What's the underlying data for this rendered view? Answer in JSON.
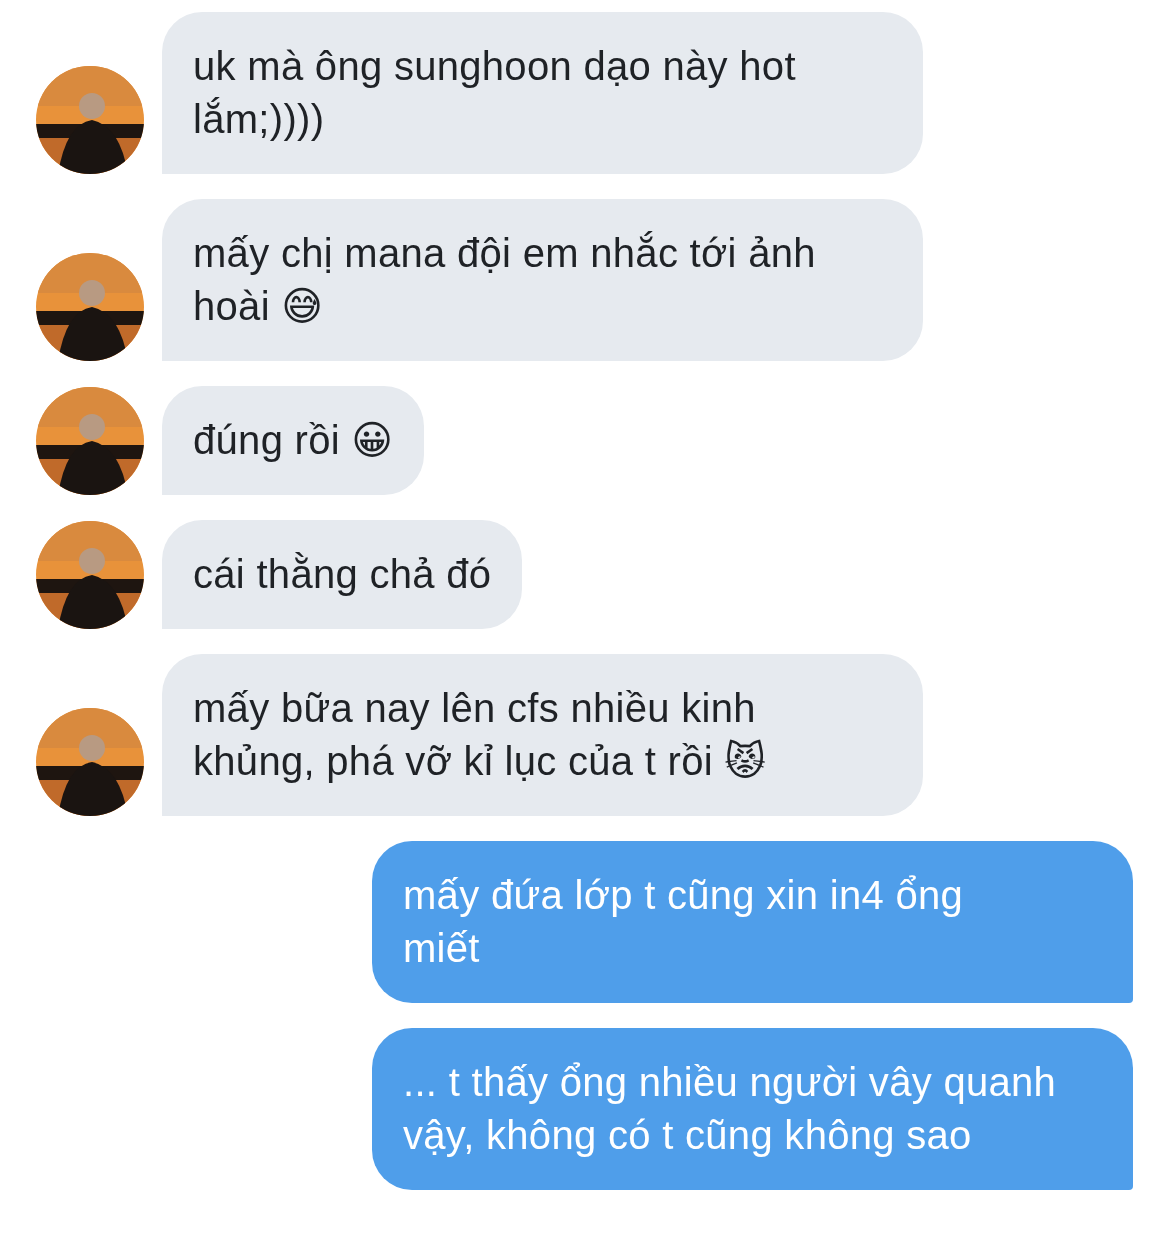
{
  "messages": [
    {
      "outgoing": false,
      "avatar": {
        "kind": "picture"
      },
      "lines": [
        "uk mà ông sunghoon dạo này hot",
        "lắm;))))"
      ]
    },
    {
      "outgoing": false,
      "avatar": {
        "kind": "picture"
      },
      "lines": [
        "mấy chị mana đội em nhắc tới ảnh",
        "hoài 😅"
      ]
    },
    {
      "outgoing": false,
      "avatar": {
        "kind": "picture"
      },
      "lines": [
        "đúng rồi 😀"
      ]
    },
    {
      "outgoing": false,
      "avatar": {
        "kind": "picture"
      },
      "lines": [
        "cái thằng chả đó"
      ]
    },
    {
      "outgoing": false,
      "avatar": {
        "kind": "picture"
      },
      "lines": [
        "mấy bữa nay lên cfs nhiều kinh",
        "khủng, phá vỡ kỉ lục của t rồi 😾"
      ]
    },
    {
      "outgoing": true,
      "lines": [
        "mấy đứa lớp t cũng xin in4 ổng",
        "miết"
      ]
    },
    {
      "outgoing": true,
      "lines": [
        "... t thấy ổng nhiều người vây quanh",
        "vậy, không có t cũng không sao"
      ]
    }
  ]
}
